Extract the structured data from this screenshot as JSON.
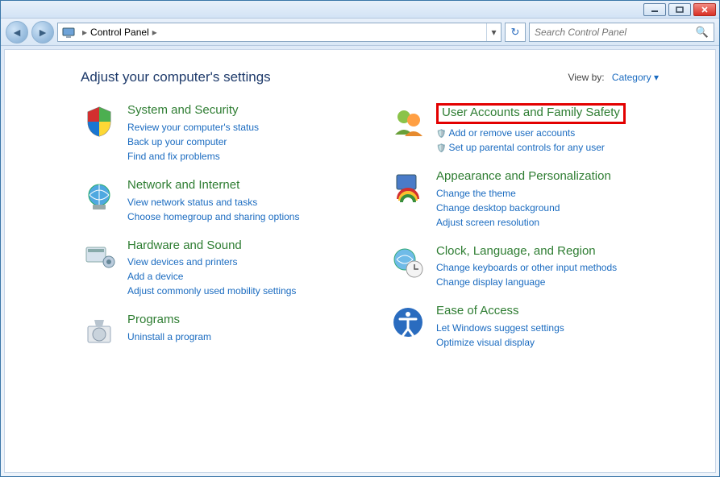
{
  "window": {
    "breadcrumb": {
      "root": "Control Panel"
    },
    "search_placeholder": "Search Control Panel"
  },
  "page": {
    "heading": "Adjust your computer's settings",
    "viewby_label": "View by:",
    "viewby_value": "Category"
  },
  "categories": {
    "system": {
      "title": "System and Security",
      "links": [
        "Review your computer's status",
        "Back up your computer",
        "Find and fix problems"
      ]
    },
    "network": {
      "title": "Network and Internet",
      "links": [
        "View network status and tasks",
        "Choose homegroup and sharing options"
      ]
    },
    "hardware": {
      "title": "Hardware and Sound",
      "links": [
        "View devices and printers",
        "Add a device",
        "Adjust commonly used mobility settings"
      ]
    },
    "programs": {
      "title": "Programs",
      "links": [
        "Uninstall a program"
      ]
    },
    "user_accounts": {
      "title": "User Accounts and Family Safety",
      "links": [
        "Add or remove user accounts",
        "Set up parental controls for any user"
      ],
      "shielded": [
        true,
        true
      ]
    },
    "appearance": {
      "title": "Appearance and Personalization",
      "links": [
        "Change the theme",
        "Change desktop background",
        "Adjust screen resolution"
      ]
    },
    "clock": {
      "title": "Clock, Language, and Region",
      "links": [
        "Change keyboards or other input methods",
        "Change display language"
      ]
    },
    "ease": {
      "title": "Ease of Access",
      "links": [
        "Let Windows suggest settings",
        "Optimize visual display"
      ]
    }
  }
}
